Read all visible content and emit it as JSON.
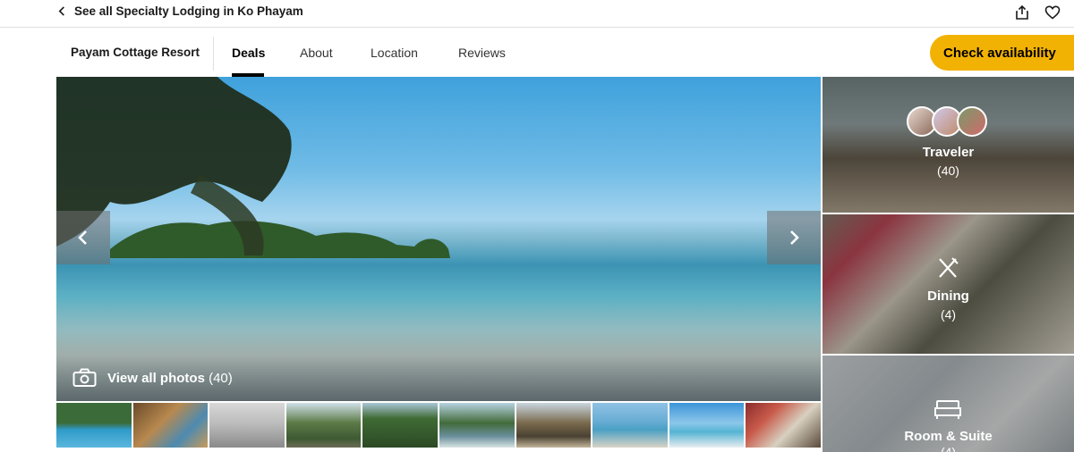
{
  "topbar": {
    "back_label": "See all Specialty Lodging in Ko Phayam",
    "icons": [
      "share-icon",
      "heart-icon"
    ]
  },
  "navbar": {
    "hotel_name": "Payam Cottage Resort",
    "tabs": [
      {
        "label": "Deals",
        "active": true
      },
      {
        "label": "About",
        "active": false
      },
      {
        "label": "Location",
        "active": false
      },
      {
        "label": "Reviews",
        "active": false
      }
    ],
    "cta_label": "Check availability",
    "accent_color": "#f2b203"
  },
  "gallery": {
    "view_all_label": "View all photos",
    "view_all_count": "(40)"
  },
  "categories": [
    {
      "label": "Traveler",
      "count": "(40)"
    },
    {
      "label": "Dining",
      "count": "(4)"
    },
    {
      "label": "Room & Suite",
      "count": "(4)"
    }
  ]
}
